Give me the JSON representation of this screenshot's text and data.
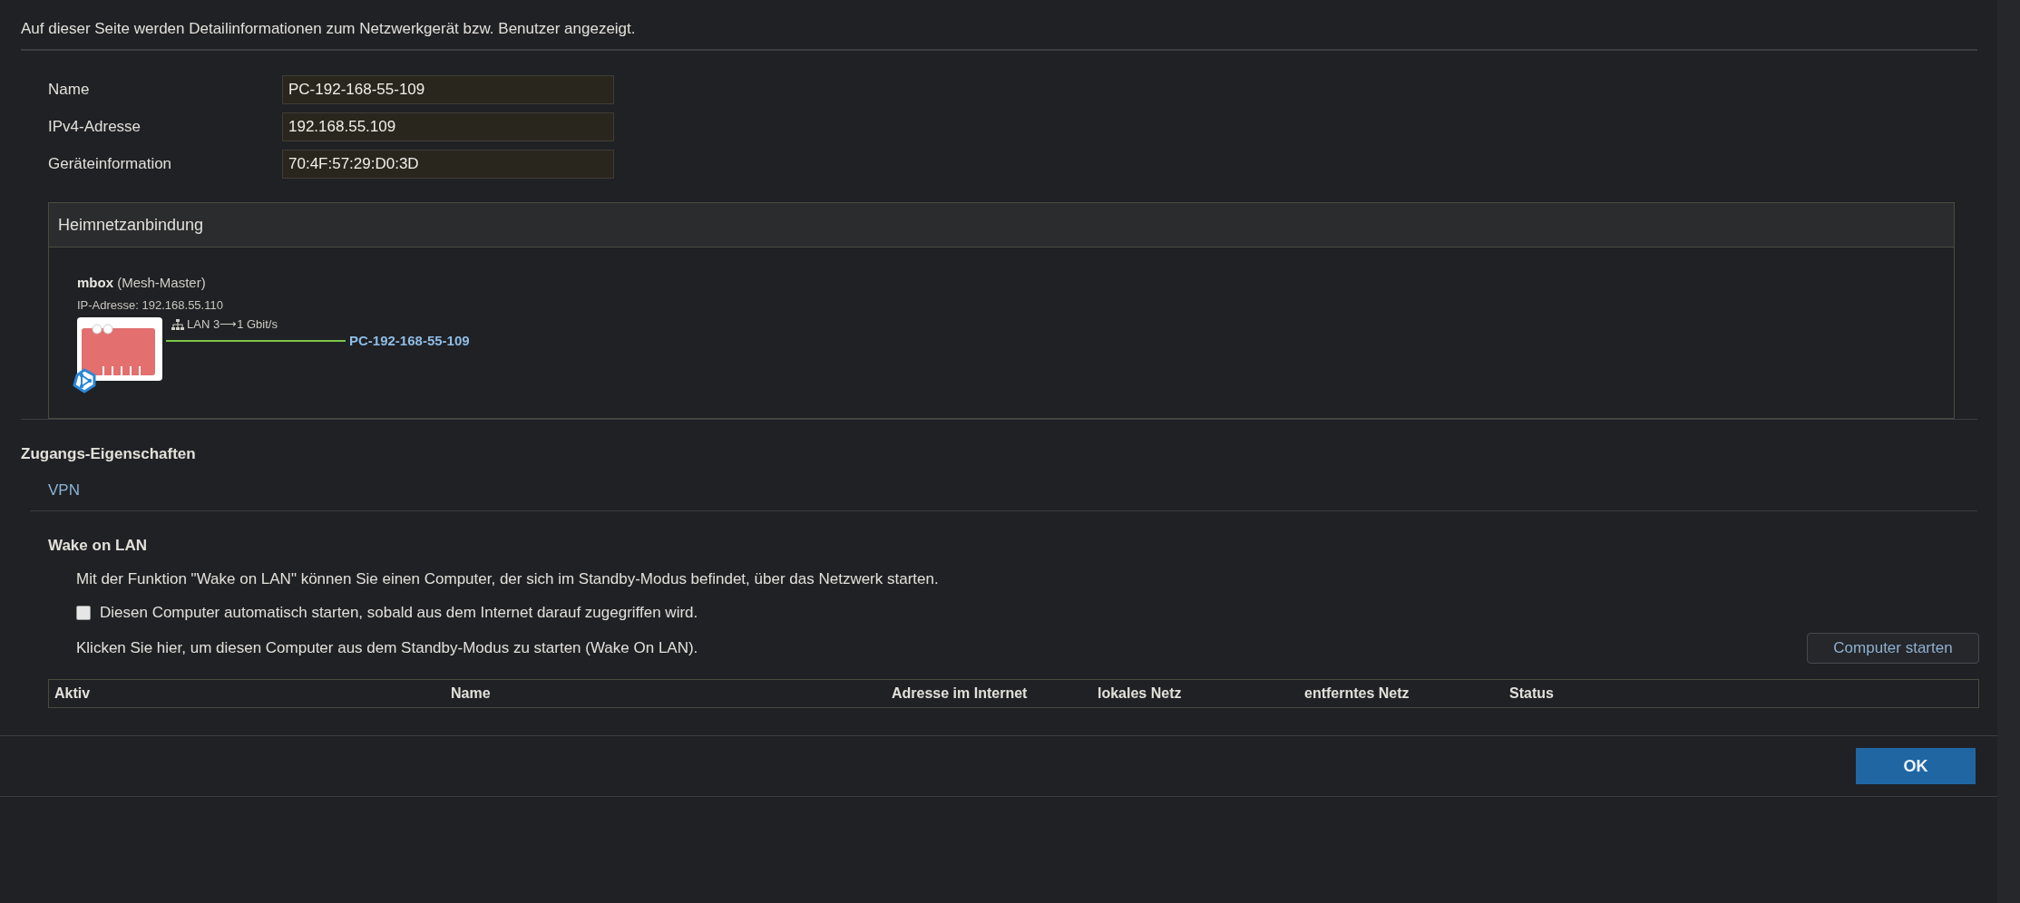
{
  "intro": "Auf dieser Seite werden Detailinformationen zum Netzwerkgerät bzw. Benutzer angezeigt.",
  "fields": [
    {
      "label": "Name",
      "value": "PC-192-168-55-109"
    },
    {
      "label": "IPv4-Adresse",
      "value": "192.168.55.109"
    },
    {
      "label": "Geräteinformation",
      "value": "70:4F:57:29:D0:3D"
    }
  ],
  "home_network": {
    "title": "Heimnetzanbindung",
    "device": {
      "name": "mbox",
      "role": "(Mesh-Master)",
      "ip": "IP-Adresse: 192.168.55.110",
      "port": "LAN 3⟶1 Gbit/s",
      "connected_device": "PC-192-168-55-109"
    }
  },
  "access": {
    "title": "Zugangs-Eigenschaften",
    "links": [
      "VPN"
    ]
  },
  "wake_on_lan": {
    "title": "Wake on LAN",
    "description": "Mit der Funktion \"Wake on LAN\" können Sie einen Computer, der sich im Standby-Modus befindet, über das Netzwerk starten.",
    "auto_start": {
      "label": "Diesen Computer automatisch starten, sobald aus dem Internet darauf zugegriffen wird.",
      "checked": false
    },
    "instruction": "Klicken Sie hier, um diesen Computer aus dem Standby-Modus zu starten (Wake On LAN).",
    "start_button": "Computer starten",
    "table": {
      "columns": [
        "Aktiv",
        "Name",
        "Adresse im Internet",
        "lokales Netz",
        "entferntes Netz",
        "Status"
      ]
    }
  },
  "buttons": [
    "OK"
  ]
}
